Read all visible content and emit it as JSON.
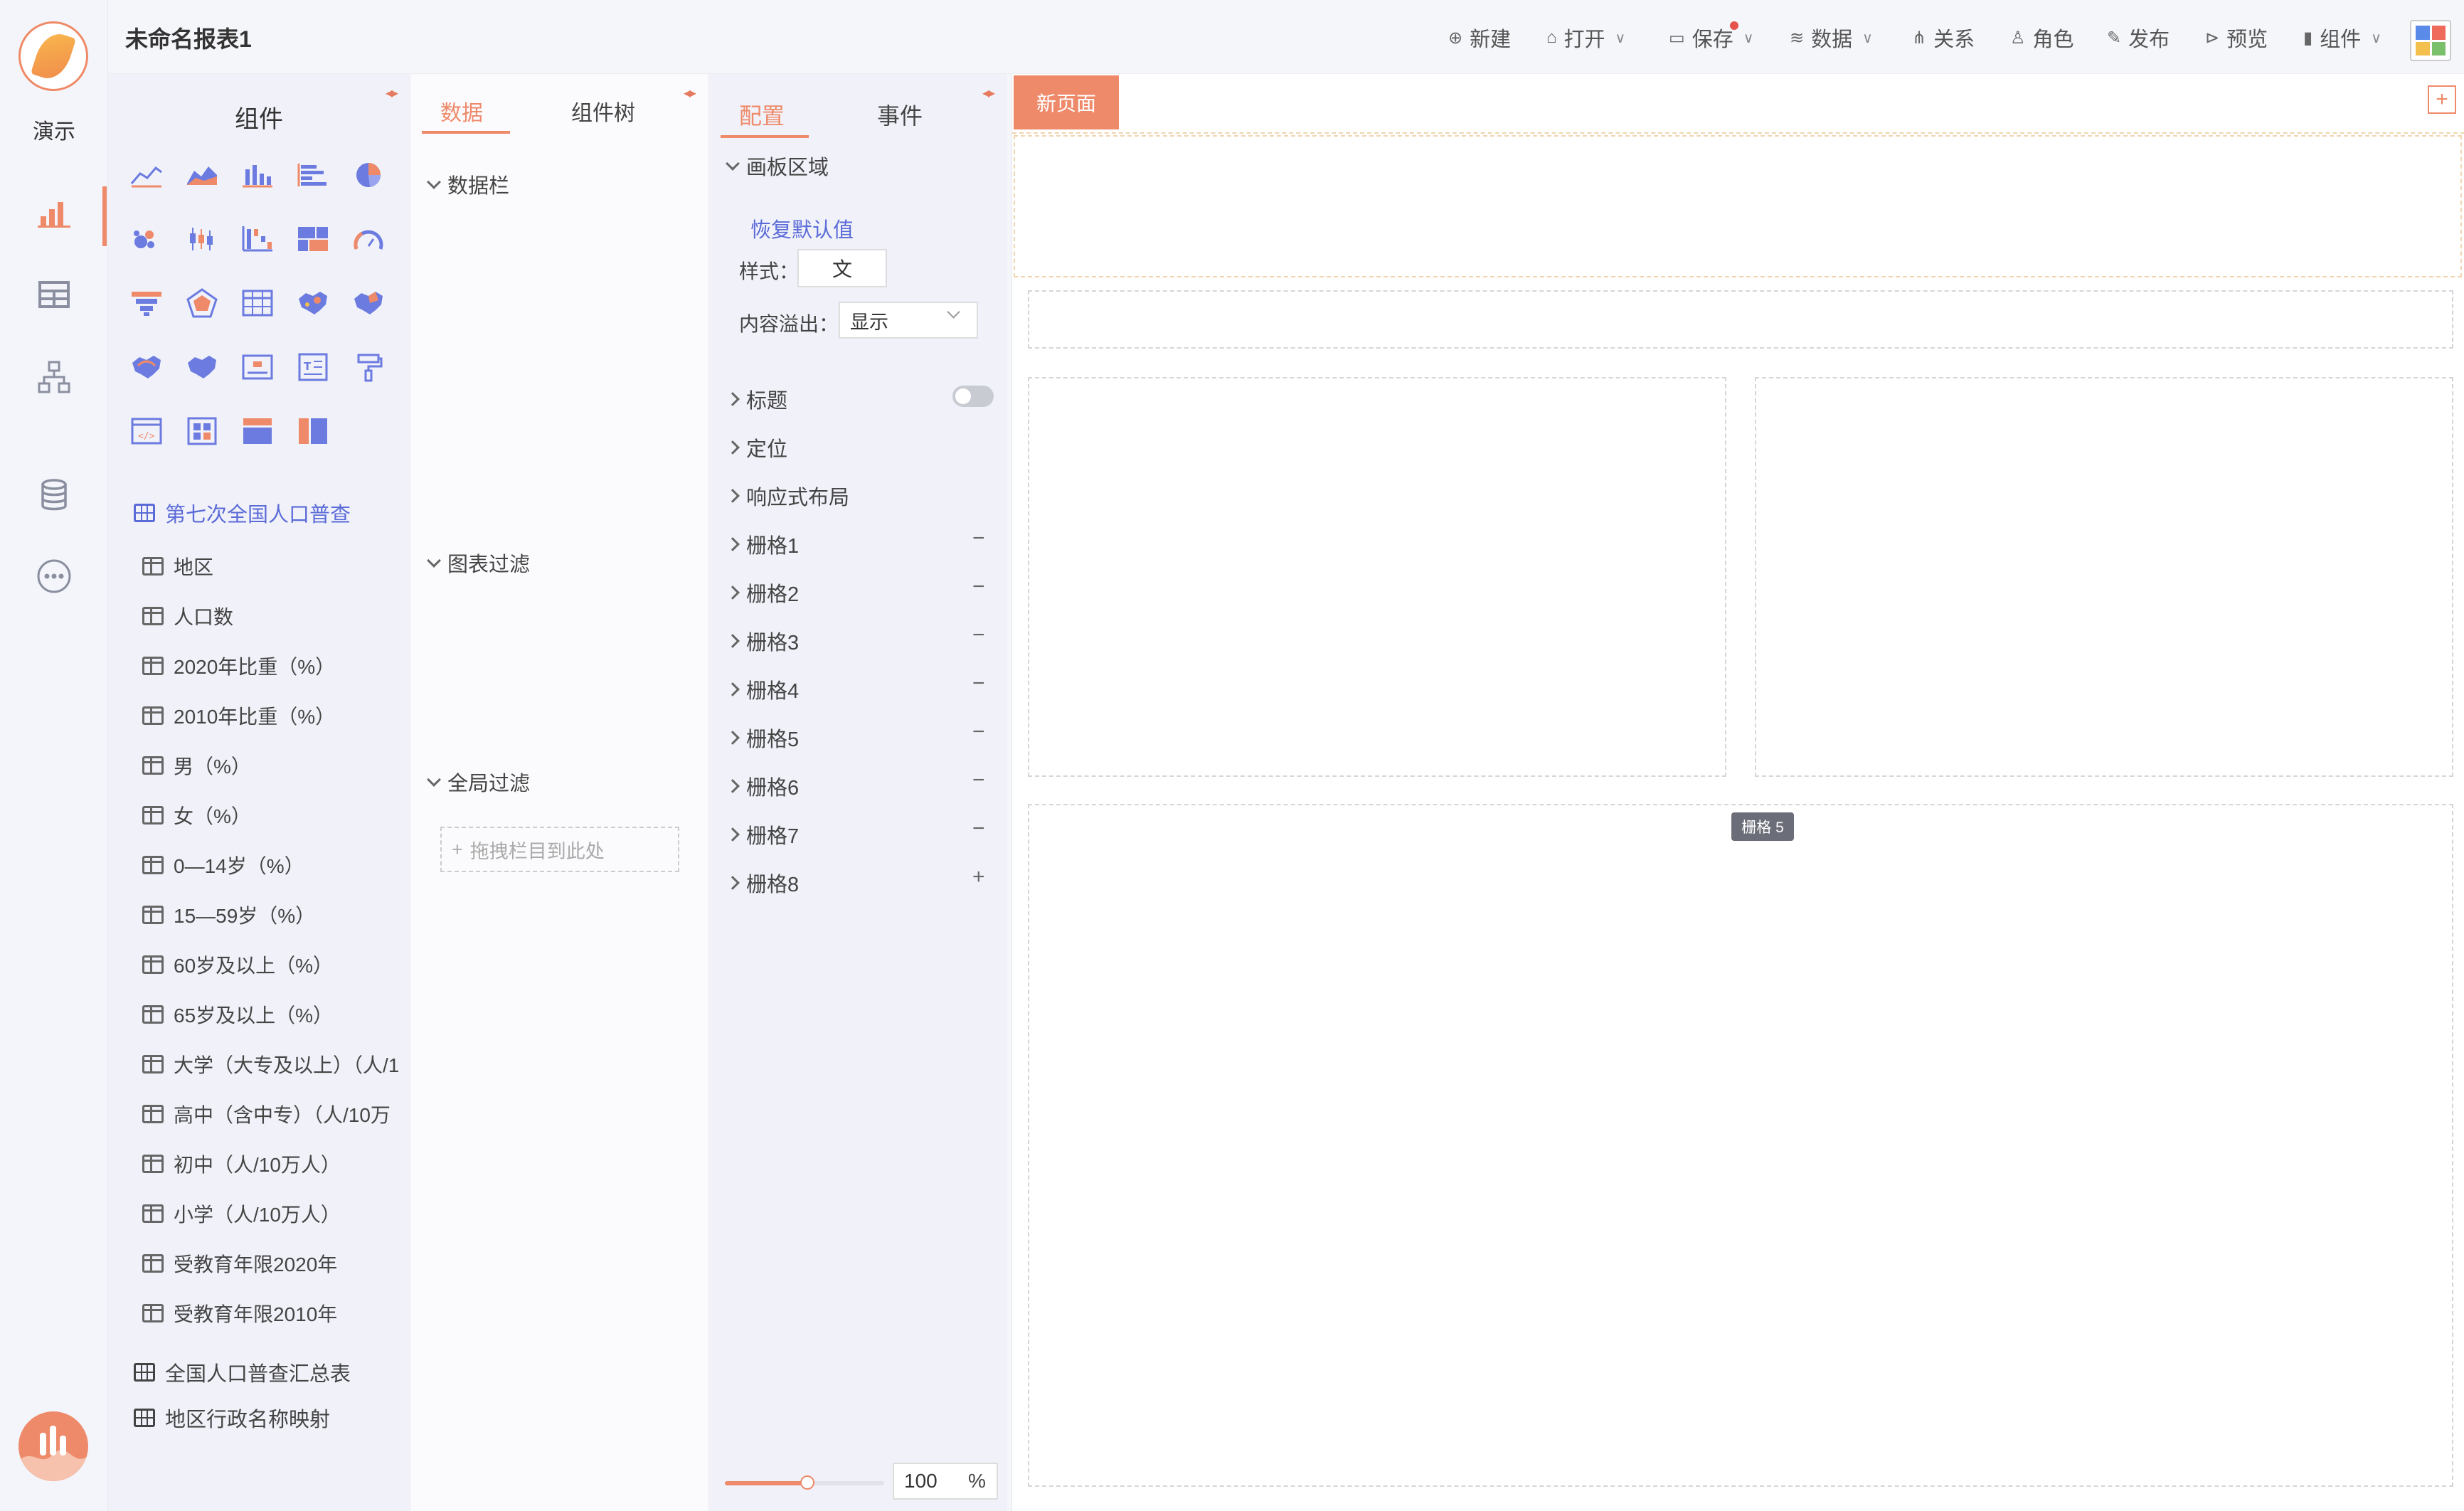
{
  "app": {
    "name": "演示",
    "report_title": "未命名报表1"
  },
  "toolbar": {
    "items": [
      "新建",
      "打开",
      "保存",
      "数据",
      "关系",
      "角色",
      "发布",
      "预览",
      "组件"
    ]
  },
  "components_panel": {
    "title": "组件",
    "dataset": "第七次全国人口普查",
    "fields": [
      "地区",
      "人口数",
      "2020年比重（%）",
      "2010年比重（%）",
      "男（%）",
      "女（%）",
      "0—14岁（%）",
      "15—59岁（%）",
      "60岁及以上（%）",
      "65岁及以上（%）",
      "大学（大专及以上）（人/1",
      "高中（含中专）（人/10万",
      "初中（人/10万人）",
      "小学（人/10万人）",
      "受教育年限2020年",
      "受教育年限2010年"
    ],
    "other_tables": [
      "全国人口普查汇总表",
      "地区行政名称映射"
    ]
  },
  "data_panel": {
    "tabs": [
      "数据",
      "组件树"
    ],
    "sections": [
      "数据栏",
      "图表过滤",
      "全局过滤"
    ],
    "drop_hint": "拖拽栏目到此处"
  },
  "config_panel": {
    "tabs": [
      "配置",
      "事件"
    ],
    "canvas_section": "画板区域",
    "restore_default": "恢复默认值",
    "style_label": "样式：",
    "style_value": "文",
    "overflow_label": "内容溢出：",
    "overflow_value": "显示",
    "sections": [
      "标题",
      "定位",
      "响应式布局"
    ],
    "grids": [
      {
        "name": "栅格1",
        "action": "−"
      },
      {
        "name": "栅格2",
        "action": "−"
      },
      {
        "name": "栅格3",
        "action": "−"
      },
      {
        "name": "栅格4",
        "action": "−"
      },
      {
        "name": "栅格5",
        "action": "−"
      },
      {
        "name": "栅格6",
        "action": "−"
      },
      {
        "name": "栅格7",
        "action": "−"
      },
      {
        "name": "栅格8",
        "action": "+"
      }
    ],
    "zoom": {
      "value": "100",
      "unit": "%"
    }
  },
  "canvas": {
    "page_tab": "新页面",
    "add_page": "+",
    "tooltip": "栅格 5"
  },
  "colors": {
    "accent": "#ee8a6a",
    "link": "#5b6bd8"
  }
}
